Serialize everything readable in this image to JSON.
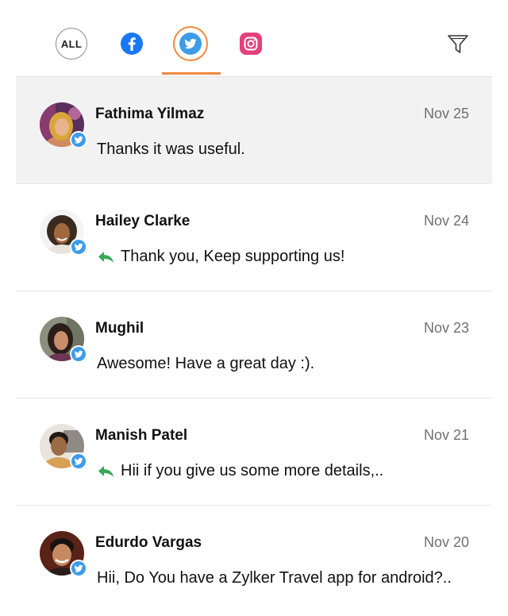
{
  "tabs": [
    {
      "id": "all",
      "label": "ALL",
      "icon": "all-icon",
      "active": false
    },
    {
      "id": "facebook",
      "label": "",
      "icon": "facebook-icon",
      "active": false,
      "color": "#1877f2"
    },
    {
      "id": "twitter",
      "label": "",
      "icon": "twitter-icon",
      "active": true,
      "color": "#3d9be9"
    },
    {
      "id": "instagram",
      "label": "",
      "icon": "instagram-icon",
      "active": false,
      "color": "#e4407a"
    }
  ],
  "filter": {
    "icon": "filter-icon"
  },
  "accent_color": "#f0883e",
  "messages": [
    {
      "name": "Fathima Yilmaz",
      "date": "Nov 25",
      "text": "Thanks it was useful.",
      "replied": false,
      "selected": true,
      "network": "twitter"
    },
    {
      "name": "Hailey Clarke",
      "date": "Nov 24",
      "text": "Thank you, Keep supporting us!",
      "replied": true,
      "selected": false,
      "network": "twitter"
    },
    {
      "name": "Mughil",
      "date": "Nov 23",
      "text": "Awesome! Have a great day :).",
      "replied": false,
      "selected": false,
      "network": "twitter"
    },
    {
      "name": "Manish Patel",
      "date": "Nov 21",
      "text": "Hii if you give us some more details,..",
      "replied": true,
      "selected": false,
      "network": "twitter"
    },
    {
      "name": "Edurdo Vargas",
      "date": "Nov 20",
      "text": "Hii, Do You have a Zylker Travel app for android?..",
      "replied": false,
      "selected": false,
      "network": "twitter"
    }
  ]
}
